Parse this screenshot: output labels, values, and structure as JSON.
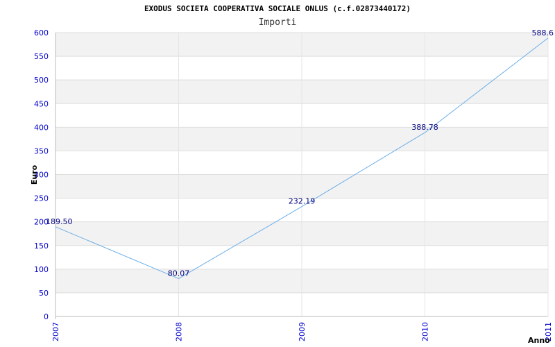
{
  "chart_data": {
    "type": "line",
    "title": "EXODUS SOCIETA COOPERATIVA SOCIALE ONLUS (c.f.02873440172)",
    "subtitle": "Importi",
    "xlabel": "Anno",
    "ylabel": "Euro",
    "categories": [
      "2007",
      "2008",
      "2009",
      "2010",
      "2011"
    ],
    "series": [
      {
        "values": [
          189.5,
          80.07,
          232.19,
          388.78,
          588.6
        ],
        "labels": [
          "189.50",
          "80.07",
          "232.19",
          "388.78",
          "588.6"
        ]
      }
    ],
    "ylim": [
      0,
      600
    ],
    "yticks": [
      "0",
      "50",
      "100",
      "150",
      "200",
      "250",
      "300",
      "350",
      "400",
      "450",
      "500",
      "550",
      "600"
    ],
    "grid": true,
    "colors": {
      "line": "#6aaee8",
      "band": "#f2f2f2",
      "tick": "#0000cc",
      "label": "#000080"
    }
  }
}
